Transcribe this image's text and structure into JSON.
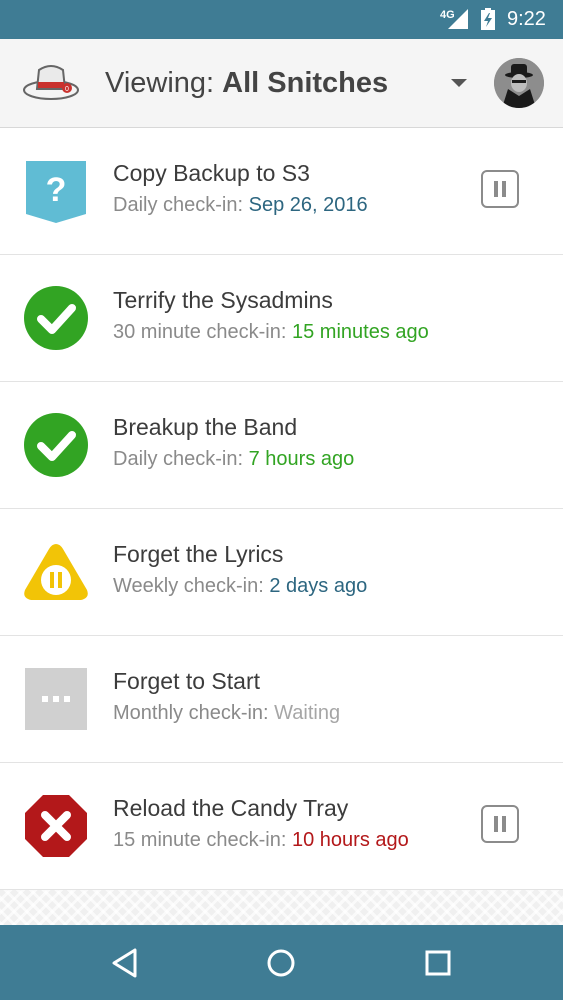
{
  "status_bar": {
    "network": "4G",
    "time": "9:22"
  },
  "app_bar": {
    "title_prefix": "Viewing: ",
    "title_value": "All Snitches",
    "logo_icon": "fedora-hat-logo-icon",
    "menu_icon": "dropdown-arrow-icon",
    "avatar_icon": "spy-avatar-icon",
    "colors": {
      "background": "#f5f5f5",
      "text": "#444444"
    }
  },
  "snitches": [
    {
      "name": "Copy Backup to S3",
      "interval": "Daily check-in: ",
      "last": "Sep 26, 2016",
      "last_color": "#2d6680",
      "icon": "question-pennant-icon",
      "has_pause": true
    },
    {
      "name": "Terrify the Sysadmins",
      "interval": "30 minute check-in: ",
      "last": "15 minutes ago",
      "last_color": "#32a423",
      "icon": "check-circle-icon",
      "has_pause": false
    },
    {
      "name": "Breakup the Band",
      "interval": "Daily check-in: ",
      "last": "7 hours ago",
      "last_color": "#32a423",
      "icon": "check-circle-icon",
      "has_pause": false
    },
    {
      "name": "Forget the Lyrics",
      "interval": "Weekly check-in: ",
      "last": "2 days ago",
      "last_color": "#2d6680",
      "icon": "pause-triangle-icon",
      "has_pause": false
    },
    {
      "name": "Forget to Start",
      "interval": "Monthly check-in: ",
      "last": "Waiting",
      "last_color": "#a6a6a6",
      "icon": "waiting-dots-icon",
      "has_pause": false
    },
    {
      "name": "Reload the Candy Tray",
      "interval": "15 minute check-in: ",
      "last": "10 hours ago",
      "last_color": "#b3181a",
      "icon": "error-octagon-icon",
      "has_pause": true
    }
  ],
  "nav_bar": {
    "back_icon": "back-triangle-icon",
    "home_icon": "home-circle-icon",
    "recents_icon": "recents-square-icon",
    "color": "#3f7c94"
  },
  "colors": {
    "accent": "#3f7c94",
    "success": "#32a423",
    "warning": "#f2c407",
    "error": "#b3181a",
    "info": "#60bcd4",
    "pending": "#d0d0d0"
  }
}
